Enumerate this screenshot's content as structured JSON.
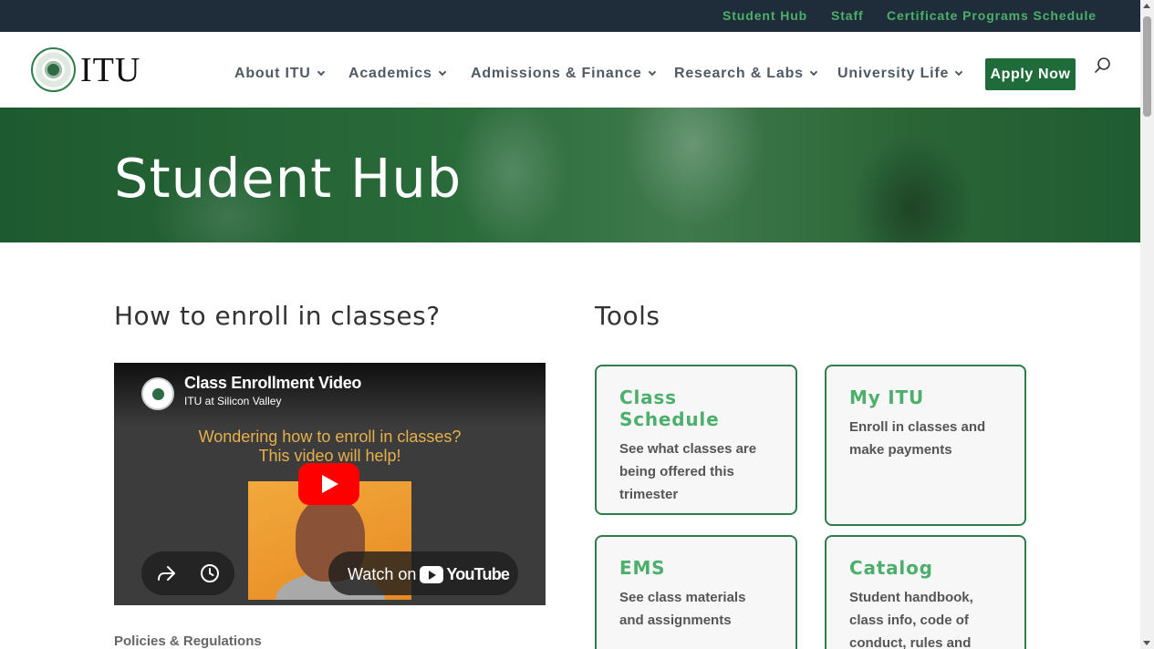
{
  "topbar": {
    "links": [
      "Student Hub",
      "Staff",
      "Certificate Programs Schedule"
    ]
  },
  "header": {
    "logo_text": "ITU",
    "nav": [
      "About ITU",
      "Academics",
      "Admissions & Finance",
      "Research & Labs",
      "University Life"
    ],
    "apply_label": "Apply Now",
    "search_icon": "search-icon"
  },
  "hero": {
    "title": "Student Hub"
  },
  "enroll": {
    "title": "How to enroll in classes?",
    "video": {
      "title": "Class Enrollment Video",
      "channel": "ITU at Silicon Valley",
      "caption_line1": "Wondering how to enroll in classes?",
      "caption_line2": "This video will help!",
      "watch_on": "Watch on",
      "youtube": "YouTube"
    },
    "policies_label": "Policies & Regulations"
  },
  "tools": {
    "title": "Tools",
    "cards": [
      {
        "title": "Class Schedule",
        "desc": "See what classes are being offered this trimester"
      },
      {
        "title": "My ITU",
        "desc": "Enroll in classes and make payments"
      },
      {
        "title": "EMS",
        "desc": "See class materials and assignments"
      },
      {
        "title": "Catalog",
        "desc": "Student handbook, class info, code of conduct, rules and"
      }
    ]
  },
  "colors": {
    "topbar_bg": "#1f2d3a",
    "accent_green": "#4caf6b",
    "brand_dark_green": "#1f6b3a"
  }
}
